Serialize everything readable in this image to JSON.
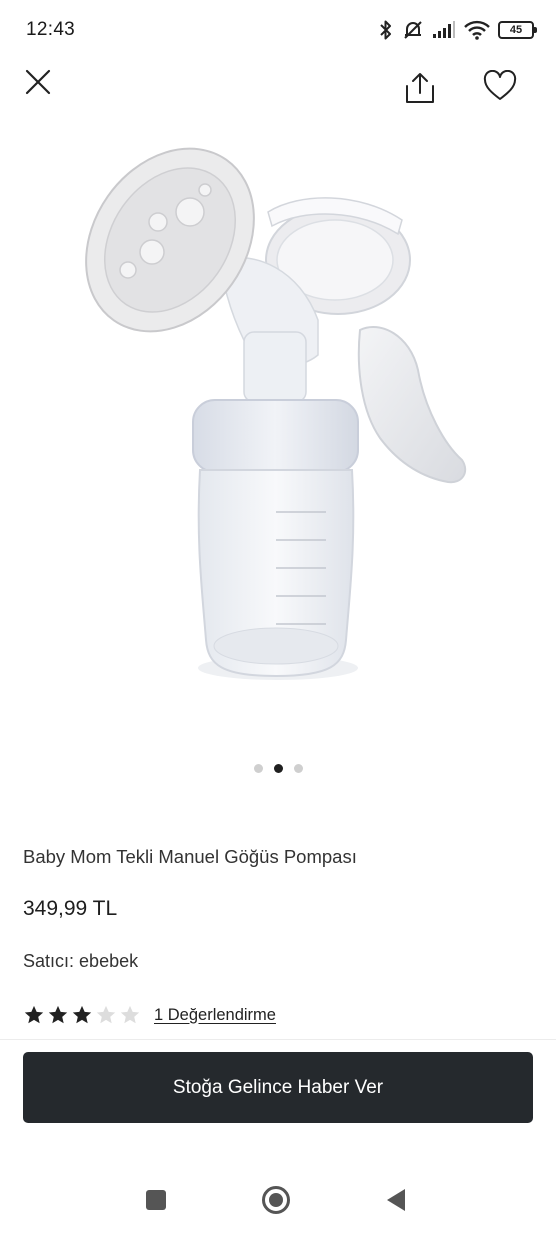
{
  "status_bar": {
    "time": "12:43",
    "battery": "45",
    "icons": [
      "bluetooth-icon",
      "muted-alarm-icon",
      "signal-icon",
      "wifi-icon",
      "battery-icon"
    ]
  },
  "top_bar": {
    "icons": [
      "close-icon",
      "share-icon",
      "heart-icon"
    ]
  },
  "gallery": {
    "page_count": 3,
    "active_page": 2
  },
  "product": {
    "title": "Baby Mom Tekli Manuel Göğüs Pompası",
    "price": "349,99 TL",
    "seller_label": "Satıcı:",
    "seller_name": "ebebek",
    "rating": 3,
    "rating_max": 5,
    "reviews_link": "1 Değerlendirme"
  },
  "cta": {
    "label": "Stoğa Gelince Haber Ver"
  },
  "navigation": {
    "icons": [
      "recents-icon",
      "home-icon",
      "back-icon"
    ]
  },
  "colors": {
    "button_bg": "#25292d",
    "star_filled": "#222222",
    "star_empty": "#dddddd",
    "dot_active": "#1f1f1f",
    "dot_inactive": "#cfcfcf"
  }
}
